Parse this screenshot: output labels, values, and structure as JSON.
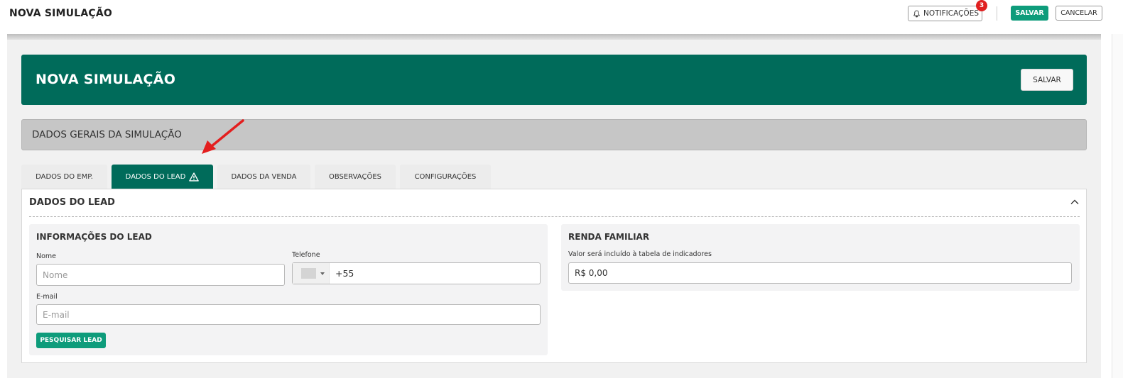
{
  "topbar": {
    "title": "NOVA SIMULAÇÃO",
    "notifications_label": "NOTIFICAÇÕES",
    "notifications_count": "3",
    "save_label": "SALVAR",
    "cancel_label": "CANCELAR"
  },
  "header": {
    "title": "NOVA SIMULAÇÃO",
    "save_label": "SALVAR"
  },
  "section": {
    "title": "DADOS GERAIS DA SIMULAÇÃO"
  },
  "tabs": [
    {
      "label": "DADOS DO EMP.",
      "active": false
    },
    {
      "label": "DADOS DO LEAD",
      "active": true,
      "icon": "warning-icon"
    },
    {
      "label": "DADOS DA VENDA",
      "active": false
    },
    {
      "label": "OBSERVAÇÕES",
      "active": false
    },
    {
      "label": "CONFIGURAÇÕES",
      "active": false
    }
  ],
  "panel": {
    "title": "DADOS DO LEAD",
    "lead_info": {
      "title": "INFORMAÇÕES DO LEAD",
      "name_label": "Nome",
      "name_placeholder": "Nome",
      "phone_label": "Telefone",
      "phone_code": "+55",
      "email_label": "E-mail",
      "email_placeholder": "E-mail",
      "search_button": "PESQUISAR LEAD"
    },
    "income": {
      "title": "RENDA FAMILIAR",
      "hint_label": "Valor será incluído à tabela de indicadores",
      "value": "R$ 0,00"
    }
  },
  "colors": {
    "brand_dark": "#006b5a",
    "brand_accent": "#0e9c7b",
    "badge_red": "#e02020",
    "annotation_arrow": "#e31e1e"
  }
}
